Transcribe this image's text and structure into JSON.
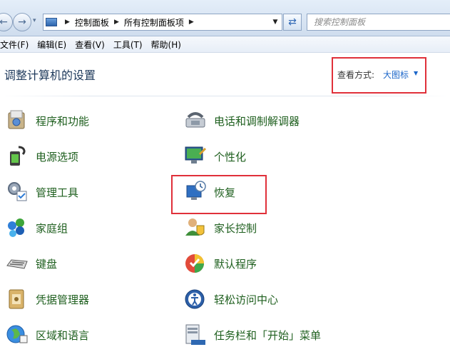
{
  "address_bar": {
    "breadcrumb": [
      "控制面板",
      "所有控制面板项"
    ],
    "search_placeholder": "搜索控制面板"
  },
  "menu": [
    "文件(F)",
    "编辑(E)",
    "查看(V)",
    "工具(T)",
    "帮助(H)"
  ],
  "header": {
    "title": "调整计算机的设置",
    "view_label": "查看方式:",
    "view_value": "大图标"
  },
  "items_left": [
    {
      "label": "程序和功能",
      "icon": "programs-features-icon"
    },
    {
      "label": "电源选项",
      "icon": "power-options-icon"
    },
    {
      "label": "管理工具",
      "icon": "admin-tools-icon"
    },
    {
      "label": "家庭组",
      "icon": "homegroup-icon"
    },
    {
      "label": "键盘",
      "icon": "keyboard-icon"
    },
    {
      "label": "凭据管理器",
      "icon": "credential-manager-icon"
    },
    {
      "label": "区域和语言",
      "icon": "region-language-icon"
    }
  ],
  "items_right": [
    {
      "label": "电话和调制解调器",
      "icon": "phone-modem-icon"
    },
    {
      "label": "个性化",
      "icon": "personalization-icon"
    },
    {
      "label": "恢复",
      "icon": "recovery-icon"
    },
    {
      "label": "家长控制",
      "icon": "parental-controls-icon"
    },
    {
      "label": "默认程序",
      "icon": "default-programs-icon"
    },
    {
      "label": "轻松访问中心",
      "icon": "ease-of-access-icon"
    },
    {
      "label": "任务栏和「开始」菜单",
      "icon": "taskbar-start-menu-icon"
    }
  ],
  "colors": {
    "highlight_border": "#e0303a",
    "item_text": "#1e5f1e",
    "link_blue": "#1b66c9"
  }
}
